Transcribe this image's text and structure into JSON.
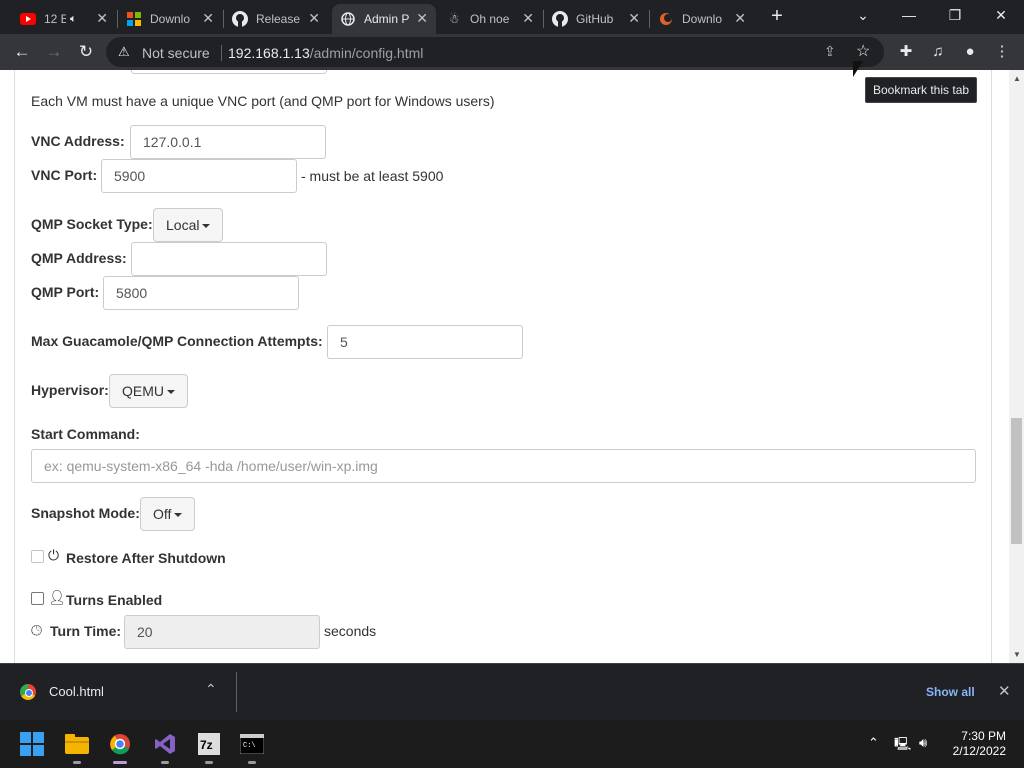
{
  "browser": {
    "tabs": [
      {
        "title": "12 E",
        "favicon": "youtube-icon",
        "extra": "speaker-icon"
      },
      {
        "title": "Downlo",
        "favicon": "microsoft-icon"
      },
      {
        "title": "Release",
        "favicon": "github-icon"
      },
      {
        "title": "Admin P",
        "favicon": "globe-icon",
        "active": true
      },
      {
        "title": "Oh noe",
        "favicon": "oh-noes-icon"
      },
      {
        "title": "GitHub",
        "favicon": "github-icon"
      },
      {
        "title": "Downlo",
        "favicon": "pale-moon-icon"
      }
    ],
    "address": {
      "security": "Not secure",
      "host": "192.168.1.13",
      "path": "/admin/config.html"
    },
    "tooltip": "Bookmark this tab"
  },
  "form": {
    "unique_note": "Each VM must have a unique VNC port (and QMP port for Windows users)",
    "vnc_address_label": "VNC Address:",
    "vnc_address_value": "127.0.0.1",
    "vnc_port_label": "VNC Port:",
    "vnc_port_value": "5900",
    "vnc_port_hint": "- must be at least 5900",
    "qmp_socket_label": "QMP Socket Type:",
    "qmp_socket_value": "Local",
    "qmp_address_label": "QMP Address:",
    "qmp_address_value": "",
    "qmp_port_label": "QMP Port:",
    "qmp_port_value": "5800",
    "max_attempts_label": "Max Guacamole/QMP Connection Attempts:",
    "max_attempts_value": "5",
    "hypervisor_label": "Hypervisor:",
    "hypervisor_value": "QEMU",
    "start_command_label": "Start Command:",
    "start_command_placeholder": "ex: qemu-system-x86_64 -hda /home/user/win-xp.img",
    "snapshot_label": "Snapshot Mode:",
    "snapshot_value": "Off",
    "restore_label": "Restore After Shutdown",
    "turns_label": "Turns Enabled",
    "turn_time_label": "Turn Time:",
    "turn_time_value": "20",
    "turn_time_unit": "seconds"
  },
  "downloads": {
    "file": "Cool.html",
    "show_all": "Show all"
  },
  "taskbar": {
    "time": "7:30 PM",
    "date": "2/12/2022",
    "apps": [
      "start-icon",
      "file-explorer-icon",
      "chrome-icon",
      "visual-studio-icon",
      "7zip-icon",
      "terminal-icon"
    ]
  }
}
